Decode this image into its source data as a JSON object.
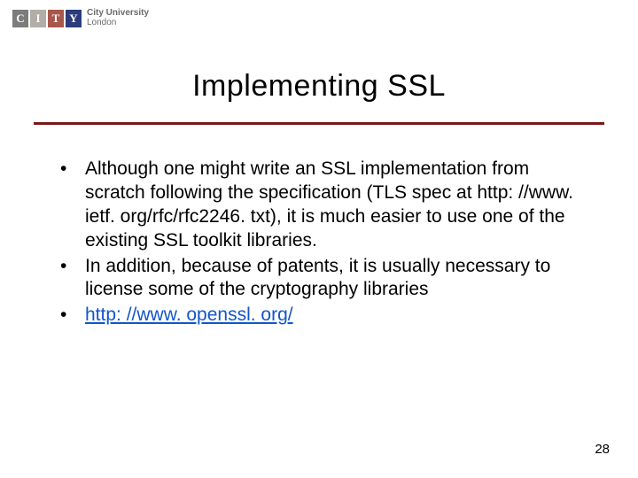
{
  "logo": {
    "letters": [
      "C",
      "I",
      "T",
      "Y"
    ],
    "text_line1": "City University",
    "text_line2": "London"
  },
  "title": "Implementing SSL",
  "bullets": [
    "Although one might write an SSL implementation from scratch following the specification (TLS spec at http: //www. ietf. org/rfc/rfc2246. txt), it is much easier to use one of the existing SSL toolkit libraries.",
    "In addition, because of patents, it is usually necessary to license some of the cryptography libraries"
  ],
  "link_bullet": "http: //www. openssl. org/",
  "page_number": "28"
}
